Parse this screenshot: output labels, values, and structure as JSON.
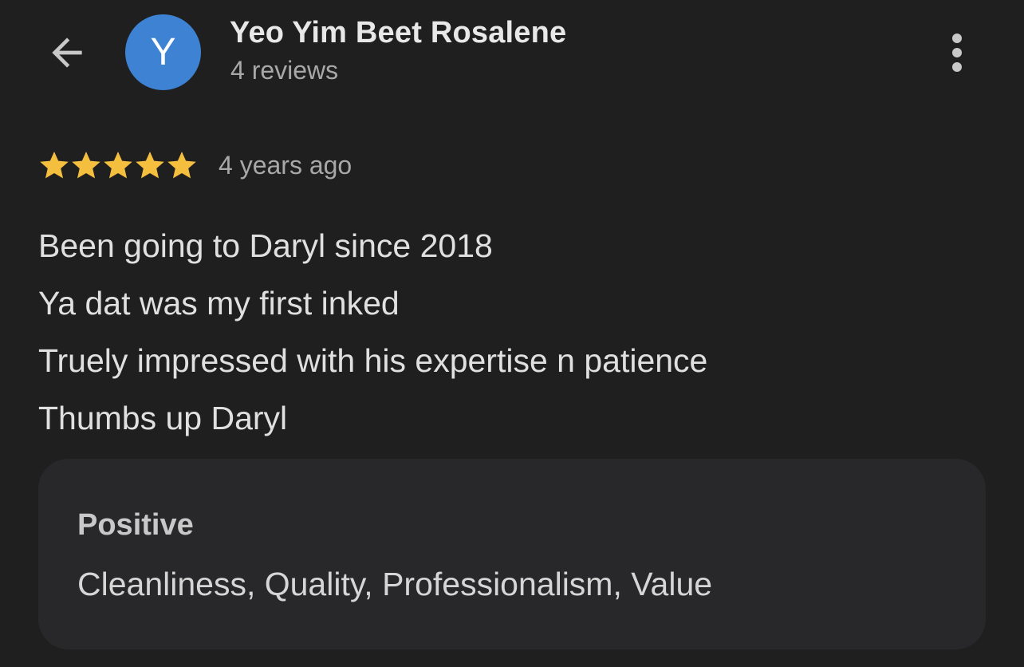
{
  "header": {
    "avatar_initial": "Y",
    "reviewer_name": "Yeo Yim Beet Rosalene",
    "review_count": "4 reviews",
    "back_icon": "arrow-left-icon",
    "more_icon": "more-vertical-icon"
  },
  "review": {
    "rating": 5,
    "rating_max": 5,
    "date": "4 years ago",
    "lines": [
      "Been going to Daryl since 2018",
      "Ya dat was my first inked",
      "Truely impressed with his expertise n patience",
      "Thumbs up Daryl"
    ]
  },
  "highlights": {
    "title": "Positive",
    "text": "Cleanliness, Quality, Professionalism, Value"
  },
  "colors": {
    "background": "#1f1f1f",
    "avatar": "#3e82d3",
    "star": "#f4bf3f",
    "card": "#28282a"
  }
}
